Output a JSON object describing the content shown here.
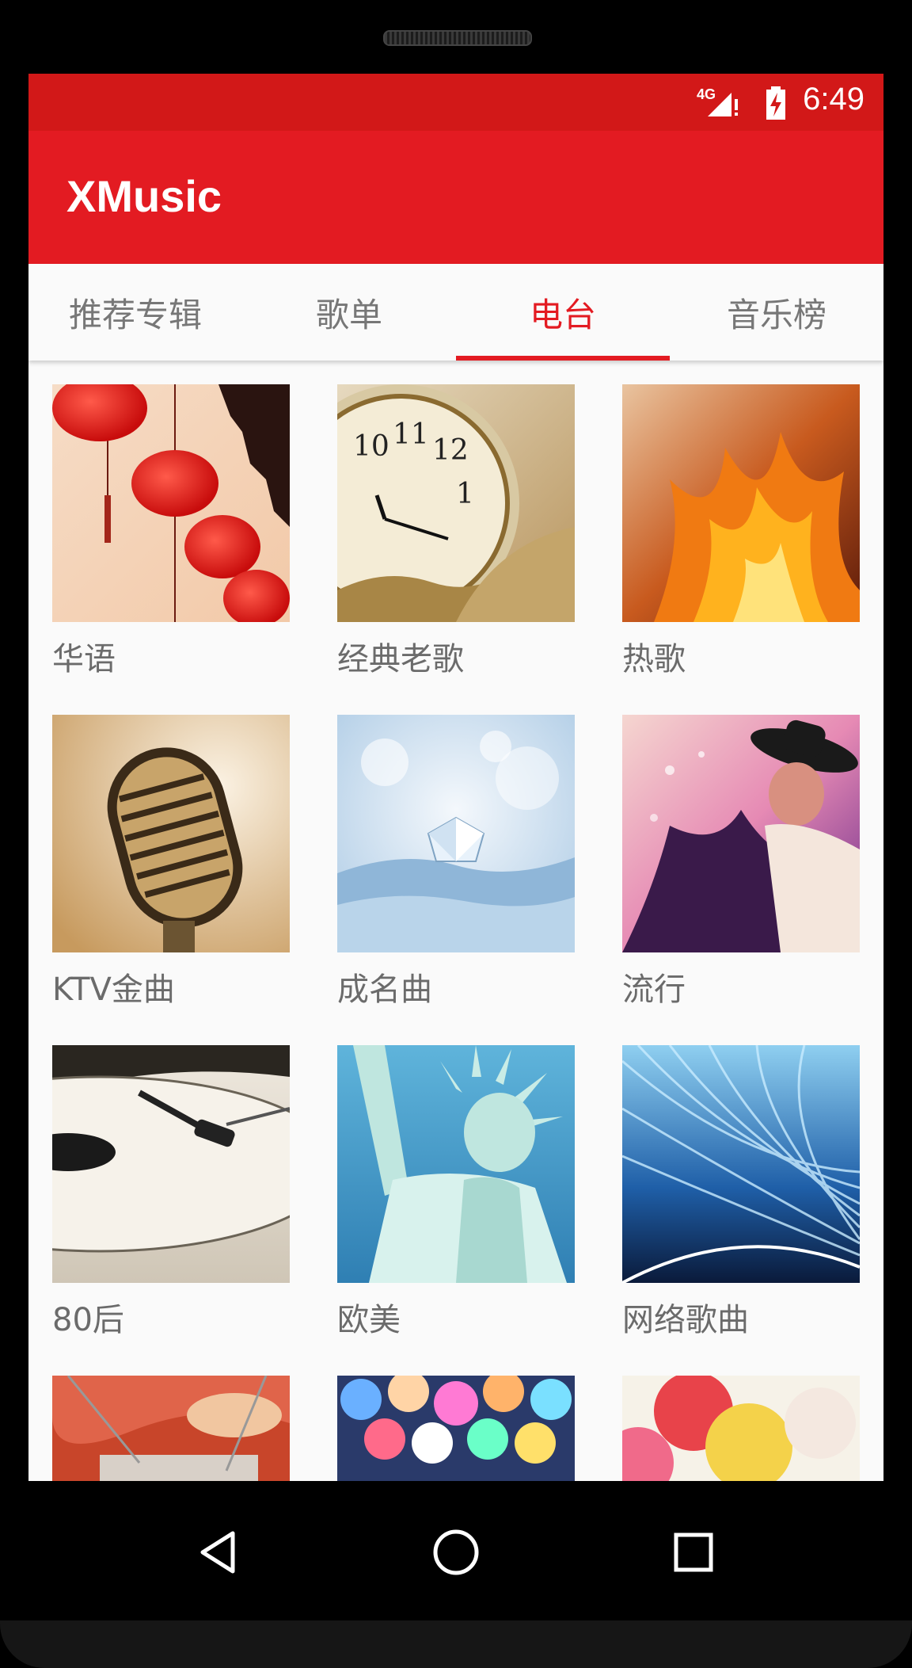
{
  "status_bar": {
    "time": "6:49",
    "network": "4G",
    "signal_icon": "signal-icon",
    "battery_icon": "battery-charging-icon"
  },
  "app_bar": {
    "title": "XMusic"
  },
  "tabs": [
    {
      "label": "推荐专辑",
      "active": false
    },
    {
      "label": "歌单",
      "active": false
    },
    {
      "label": "电台",
      "active": true
    },
    {
      "label": "音乐榜",
      "active": false
    }
  ],
  "colors": {
    "status_bar": "#d21818",
    "app_bar": "#e31b22",
    "accent": "#e31b22",
    "tab_inactive": "#777777",
    "label_text": "#6b6b6b",
    "background": "#fafafa"
  },
  "radio_categories": [
    {
      "label": "华语",
      "cover": "red-lanterns"
    },
    {
      "label": "经典老歌",
      "cover": "pocket-watch"
    },
    {
      "label": "热歌",
      "cover": "fire"
    },
    {
      "label": "KTV金曲",
      "cover": "microphone"
    },
    {
      "label": "成名曲",
      "cover": "diamond"
    },
    {
      "label": "流行",
      "cover": "dancer"
    },
    {
      "label": "80后",
      "cover": "turntable"
    },
    {
      "label": "欧美",
      "cover": "statue-of-liberty"
    },
    {
      "label": "网络歌曲",
      "cover": "light-tunnel"
    },
    {
      "label": "",
      "cover": "graffiti"
    },
    {
      "label": "",
      "cover": "bokeh-lights"
    },
    {
      "label": "",
      "cover": "balloons"
    }
  ],
  "nav_bar": {
    "back_icon": "back-icon",
    "home_icon": "home-icon",
    "recents_icon": "recents-icon"
  }
}
